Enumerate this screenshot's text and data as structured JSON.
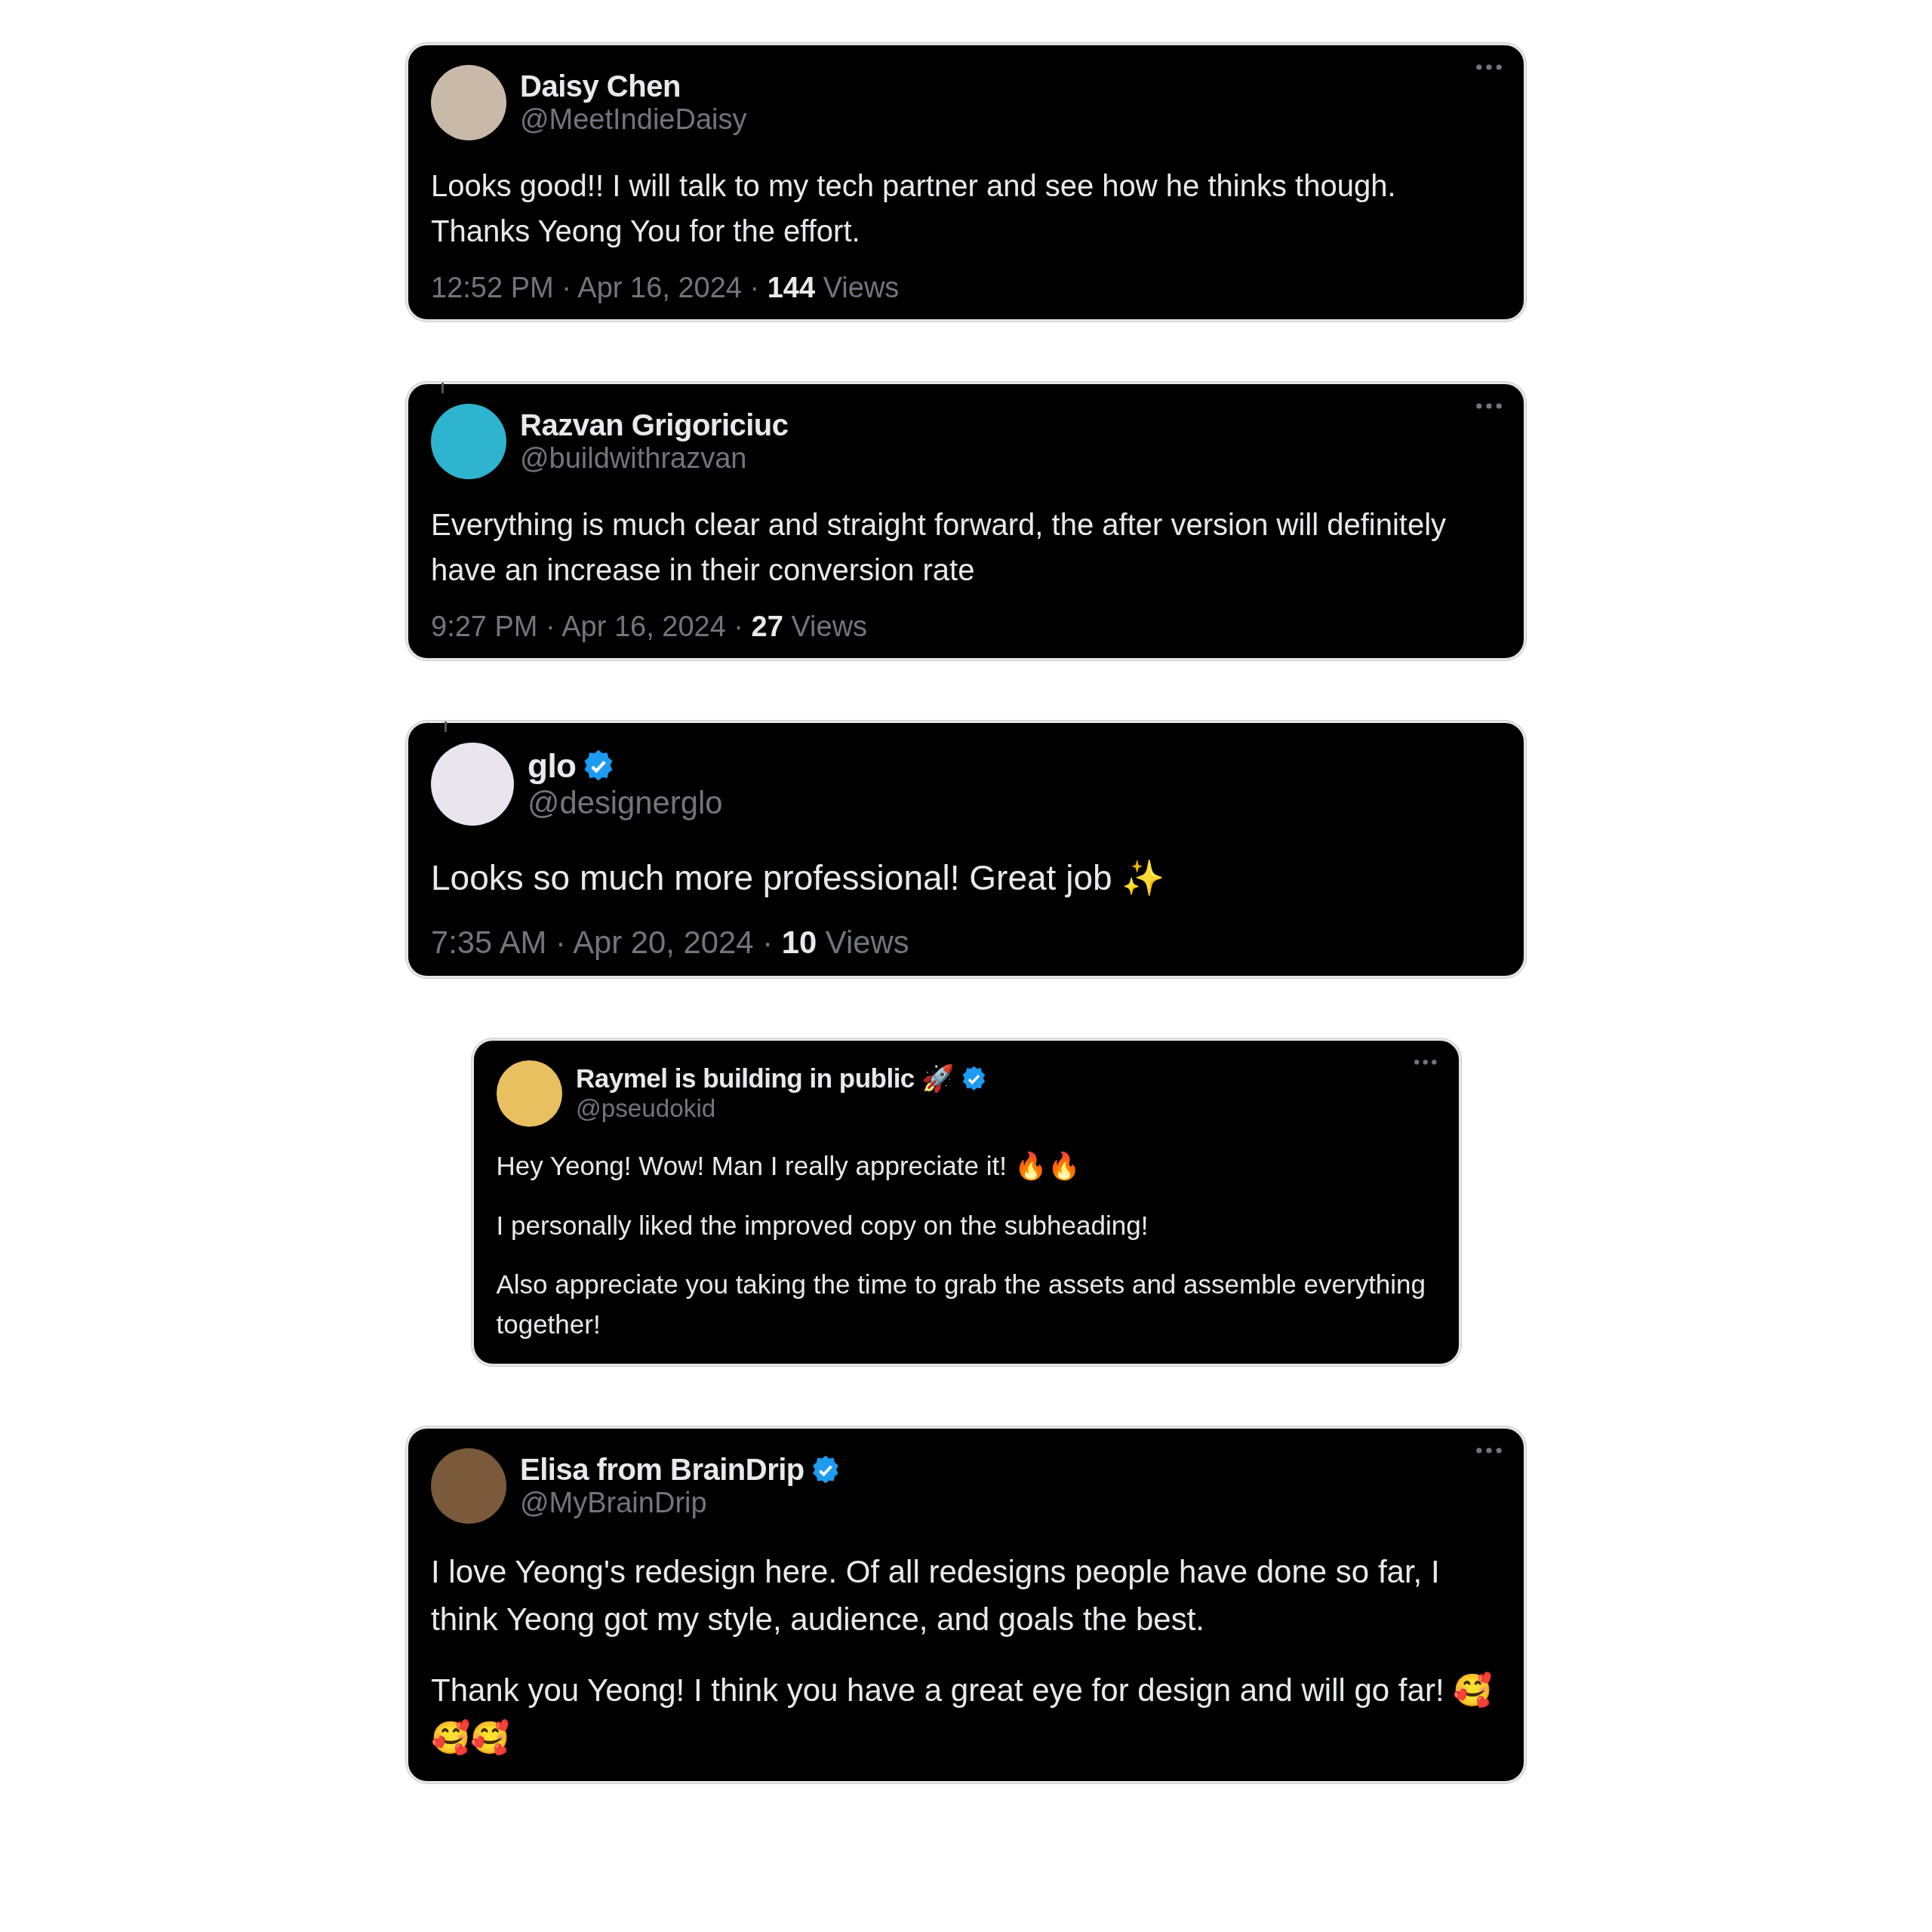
{
  "tweets": [
    {
      "name": "Daisy Chen",
      "verified": false,
      "handle": "@MeetIndieDaisy",
      "more_menu": true,
      "thread_line": false,
      "paragraphs": [
        "Looks good!! I will talk to my tech partner and see how he thinks though. Thanks Yeong You for the effort."
      ],
      "meta": "12:52 PM · Apr 16, 2024 · **144** Views"
    },
    {
      "name": "Razvan Grigoriciuc",
      "verified": false,
      "handle": "@buildwithrazvan",
      "more_menu": true,
      "thread_line": true,
      "paragraphs": [
        "Everything is much clear and straight forward, the after version will definitely have an increase in their conversion rate"
      ],
      "meta": "9:27 PM · Apr 16, 2024 · **27** Views"
    },
    {
      "name": "glo",
      "verified": true,
      "handle": "@designerglo",
      "more_menu": false,
      "thread_line": true,
      "paragraphs": [
        "Looks so much more professional! Great job ✨"
      ],
      "meta": "7:35 AM · Apr 20, 2024 · **10** Views"
    },
    {
      "name": "Raymel is building in public 🚀",
      "verified": true,
      "handle": "@pseudokid",
      "more_menu": true,
      "thread_line": false,
      "paragraphs": [
        "Hey Yeong! Wow! Man I really appreciate it! 🔥🔥",
        "I personally liked the improved copy on the subheading!",
        "Also appreciate you taking the time to grab the assets and assemble everything together!"
      ]
    },
    {
      "name": "Elisa from BrainDrip",
      "verified": true,
      "handle": "@MyBrainDrip",
      "more_menu": true,
      "thread_line": false,
      "paragraphs": [
        "I love Yeong's redesign here. Of all redesigns people have done so far, I think Yeong got my style, audience, and goals the best.",
        "Thank you Yeong! I think you have a great eye for design and will go far! 🥰🥰🥰"
      ]
    }
  ]
}
